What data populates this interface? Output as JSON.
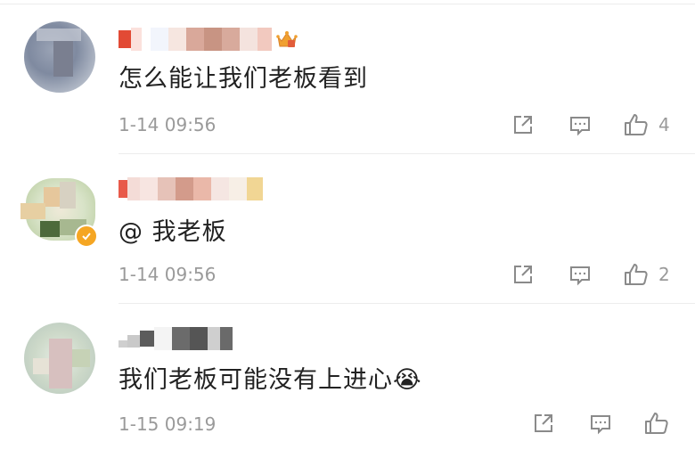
{
  "comments": [
    {
      "username_masked": "",
      "text": "怎么能让我们老板看到",
      "time": "1-14 09:56",
      "likes": "4",
      "has_crown": true,
      "verified": false
    },
    {
      "username_masked": "",
      "text": "@ 我老板",
      "time": "1-14 09:56",
      "likes": "2",
      "has_crown": false,
      "verified": true
    },
    {
      "username_masked": "",
      "text": "我们老板可能没有上进心😭",
      "time": "1-15 09:19",
      "likes": "",
      "has_crown": false,
      "verified": false
    }
  ],
  "icons": {
    "share": "share-icon",
    "comment": "comment-icon",
    "like": "thumbs-up-icon",
    "crown": "crown-badge-icon",
    "verified": "verified-badge-icon"
  },
  "colors": {
    "meta": "#9a9a9a",
    "text": "#222222",
    "divider": "#ededed",
    "verified": "#f5a623",
    "crown": "#f0a030"
  }
}
